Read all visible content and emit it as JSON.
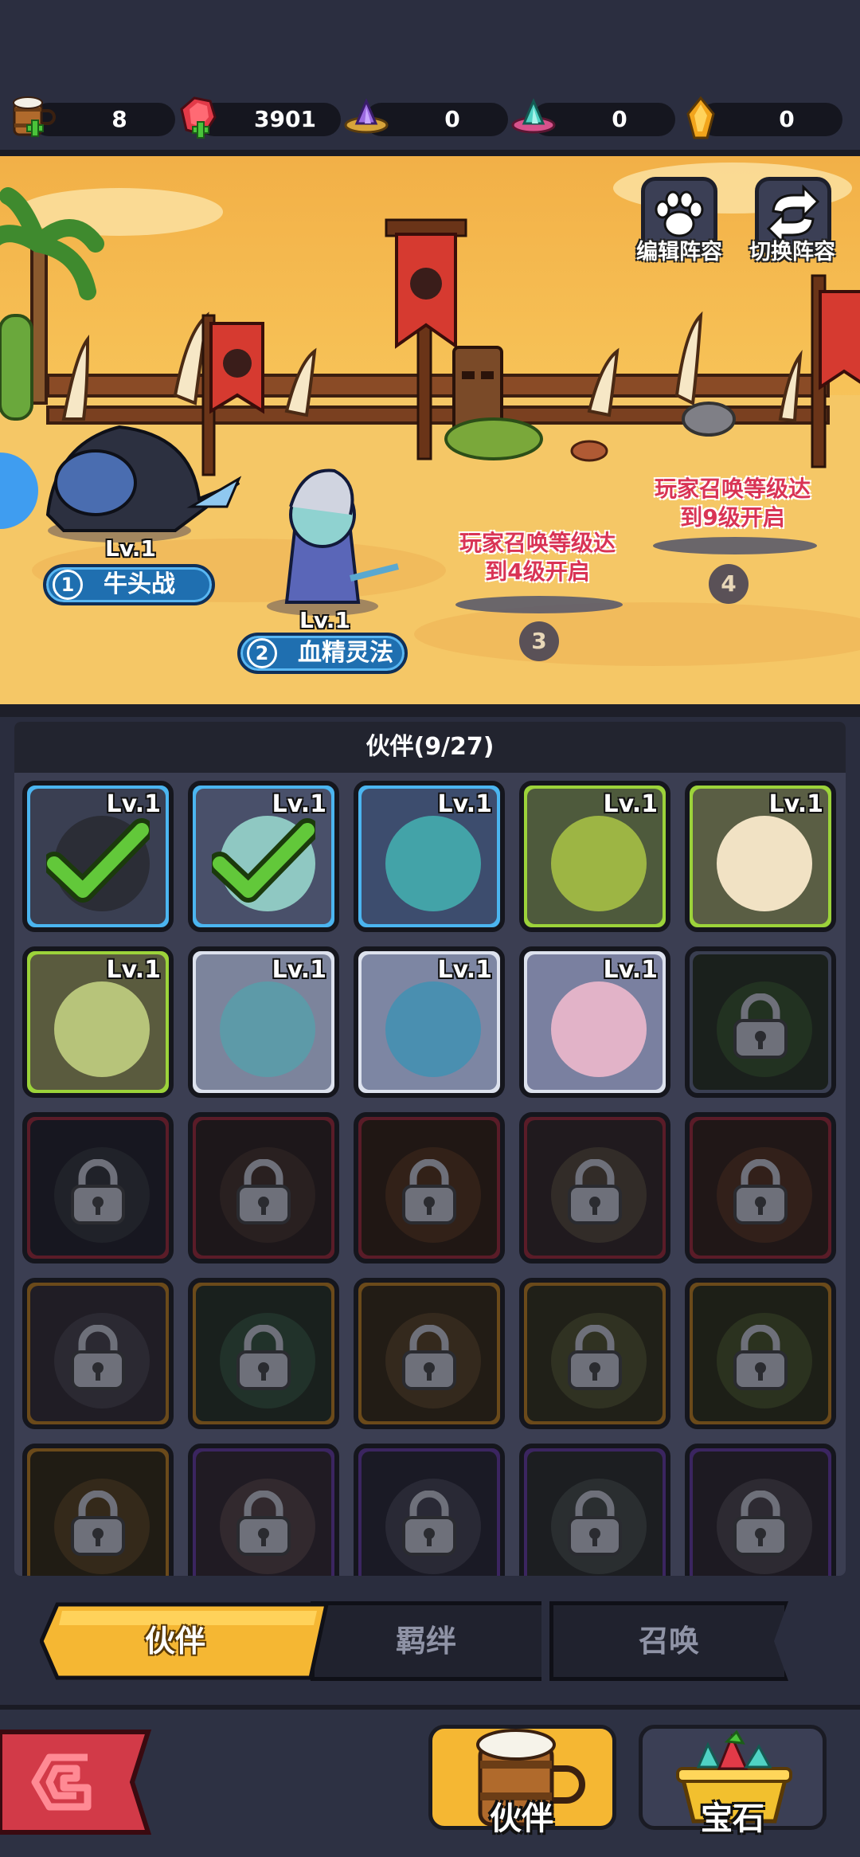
{
  "currencies": [
    {
      "icon": "beer-mug-icon",
      "value": "8"
    },
    {
      "icon": "ruby-icon",
      "value": "3901"
    },
    {
      "icon": "purple-crystal-icon",
      "value": "0"
    },
    {
      "icon": "teal-crystal-icon",
      "value": "0"
    },
    {
      "icon": "amber-crystal-icon",
      "value": "0"
    }
  ],
  "scene": {
    "edit_lineup": "编辑阵容",
    "switch_lineup": "切换阵容",
    "heroes": [
      {
        "slot": "1",
        "name": "牛头战",
        "level": "Lv.1"
      },
      {
        "slot": "2",
        "name": "血精灵法",
        "level": "Lv.1"
      }
    ],
    "locked_slots": [
      {
        "slot": "3",
        "text_line1": "玩家召唤等级达",
        "text_line2": "到4级开启"
      },
      {
        "slot": "4",
        "text_line1": "玩家召唤等级达",
        "text_line2": "到9级开启"
      }
    ]
  },
  "panel": {
    "title": "伙伴(9/27)",
    "cards": [
      {
        "level": "Lv.1",
        "frame": "#4bb5f0",
        "bg": "#3a3f52",
        "face": "#2b2d36",
        "selected": true,
        "locked": false
      },
      {
        "level": "Lv.1",
        "frame": "#4bb5f0",
        "bg": "#49506a",
        "face": "#8fc8c2",
        "selected": true,
        "locked": false
      },
      {
        "level": "Lv.1",
        "frame": "#4bb5f0",
        "bg": "#3d4d6e",
        "face": "#43a3a8",
        "selected": false,
        "locked": false
      },
      {
        "level": "Lv.1",
        "frame": "#9cd33a",
        "bg": "#4e5a3c",
        "face": "#9db544",
        "selected": false,
        "locked": false
      },
      {
        "level": "Lv.1",
        "frame": "#9cd33a",
        "bg": "#5a5e44",
        "face": "#f1e2c4",
        "selected": false,
        "locked": false
      },
      {
        "level": "Lv.1",
        "frame": "#9cd33a",
        "bg": "#5a5b3e",
        "face": "#b7c47a",
        "selected": false,
        "locked": false
      },
      {
        "level": "Lv.1",
        "frame": "#dde2ee",
        "bg": "#7c849c",
        "face": "#5d9aa8",
        "selected": false,
        "locked": false
      },
      {
        "level": "Lv.1",
        "frame": "#dde2ee",
        "bg": "#7d86a3",
        "face": "#4a8fb0",
        "selected": false,
        "locked": false
      },
      {
        "level": "Lv.1",
        "frame": "#dde2ee",
        "bg": "#7a80a0",
        "face": "#e2b3c8",
        "selected": false,
        "locked": false
      },
      {
        "level": "",
        "frame": "#3a3f52",
        "bg": "#2f3a33",
        "face": "#3e5a3c",
        "selected": false,
        "locked": true
      },
      {
        "level": "",
        "frame": "#5a1c28",
        "bg": "#2a2a3a",
        "face": "#3a3d4a",
        "selected": false,
        "locked": true
      },
      {
        "level": "",
        "frame": "#5a1c28",
        "bg": "#352a30",
        "face": "#4a3a3a",
        "selected": false,
        "locked": true
      },
      {
        "level": "",
        "frame": "#5a1c28",
        "bg": "#3a2a24",
        "face": "#5b3c2c",
        "selected": false,
        "locked": true
      },
      {
        "level": "",
        "frame": "#5a1c28",
        "bg": "#3a3036",
        "face": "#5a5048",
        "selected": false,
        "locked": true
      },
      {
        "level": "",
        "frame": "#5a1c28",
        "bg": "#3a2a2a",
        "face": "#5a3b30",
        "selected": false,
        "locked": true
      },
      {
        "level": "",
        "frame": "#6b4a1a",
        "bg": "#3a3444",
        "face": "#4e4a5a",
        "selected": false,
        "locked": true
      },
      {
        "level": "",
        "frame": "#6b4a1a",
        "bg": "#2d3a34",
        "face": "#3c5a4c",
        "selected": false,
        "locked": true
      },
      {
        "level": "",
        "frame": "#6b4a1a",
        "bg": "#3e3226",
        "face": "#5e4a34",
        "selected": false,
        "locked": true
      },
      {
        "level": "",
        "frame": "#6b4a1a",
        "bg": "#3a3a2c",
        "face": "#585a3e",
        "selected": false,
        "locked": true
      },
      {
        "level": "",
        "frame": "#6b4a1a",
        "bg": "#34392a",
        "face": "#4e5a38",
        "selected": false,
        "locked": true
      },
      {
        "level": "",
        "frame": "#6b4a1a",
        "bg": "#3a3224",
        "face": "#5e4a30",
        "selected": false,
        "locked": true
      },
      {
        "level": "",
        "frame": "#3b2560",
        "bg": "#3a3140",
        "face": "#5a4a54",
        "selected": false,
        "locked": true
      },
      {
        "level": "",
        "frame": "#3b2560",
        "bg": "#2f2f44",
        "face": "#4a4a60",
        "selected": false,
        "locked": true
      },
      {
        "level": "",
        "frame": "#3b2560",
        "bg": "#32363c",
        "face": "#4c5458",
        "selected": false,
        "locked": true
      },
      {
        "level": "",
        "frame": "#3b2560",
        "bg": "#35303e",
        "face": "#524c5a",
        "selected": false,
        "locked": true
      }
    ]
  },
  "tabs": {
    "partner": "伙伴",
    "bond": "羁绊",
    "summon": "召唤"
  },
  "bottom": {
    "partner_label": "伙伴",
    "gem_label": "宝石"
  },
  "colors": {
    "accent_yellow": "#f5b733",
    "panel": "#3b3e52",
    "background": "#2a2d3e"
  }
}
